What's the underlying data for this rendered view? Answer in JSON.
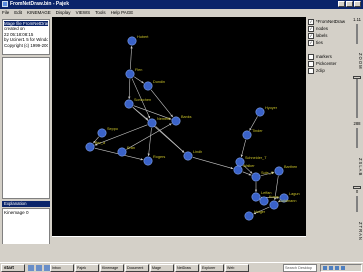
{
  "window": {
    "title": "FromNetDraw.bin - Pajek",
    "menu": [
      "File",
      "Edit",
      "KINEMAGE",
      "Display",
      "VIEWS",
      "Tools",
      "Help PAGE"
    ]
  },
  "info_lines": [
    "Mage file FromNetDraw",
    "created on",
    "22 05:18:08:15",
    "by Uciner1 5 for Windows",
    "Copyright (c) 1999-2005"
  ],
  "explanation_label": "Explanation",
  "kinemage_label": "Kinemage 0",
  "graph": {
    "node_color": "#3a62c8",
    "edge_color": "#c8c8c8",
    "label_color": "#c8c028",
    "nodes": [
      {
        "id": "A",
        "label": "Hubert"
      },
      {
        "id": "B",
        "label": "Flen"
      },
      {
        "id": "C",
        "label": "Dundin"
      },
      {
        "id": "D",
        "label": "Sonnchen"
      },
      {
        "id": "E",
        "label": "Banks"
      },
      {
        "id": "F",
        "label": "Nemeth"
      },
      {
        "id": "G",
        "label": "Seppo"
      },
      {
        "id": "H",
        "label": "Eran"
      },
      {
        "id": "I",
        "label": "Ber_a"
      },
      {
        "id": "J",
        "label": "Rogers"
      },
      {
        "id": "K",
        "label": "Lindh"
      },
      {
        "id": "L",
        "label": "Walker"
      },
      {
        "id": "M",
        "label": "Hyoyer"
      },
      {
        "id": "N",
        "label": "Tinder"
      },
      {
        "id": "O",
        "label": "Schneider_T"
      },
      {
        "id": "P",
        "label": "Sole_G"
      },
      {
        "id": "Q",
        "label": "Leffan"
      },
      {
        "id": "R",
        "label": "Lagun"
      },
      {
        "id": "S",
        "label": "Barthen"
      },
      {
        "id": "T",
        "label": "Goldmann"
      },
      {
        "id": "U",
        "label": "Kraus"
      },
      {
        "id": "V",
        "label": "Holger"
      }
    ],
    "edges": [
      [
        "B",
        "A"
      ],
      [
        "B",
        "C"
      ],
      [
        "B",
        "D"
      ],
      [
        "D",
        "E"
      ],
      [
        "C",
        "E"
      ],
      [
        "D",
        "F"
      ],
      [
        "B",
        "F"
      ],
      [
        "F",
        "I"
      ],
      [
        "G",
        "I"
      ],
      [
        "F",
        "J"
      ],
      [
        "F",
        "K"
      ],
      [
        "D",
        "K"
      ],
      [
        "K",
        "L"
      ],
      [
        "L",
        "O"
      ],
      [
        "L",
        "P"
      ],
      [
        "M",
        "N"
      ],
      [
        "N",
        "O"
      ],
      [
        "O",
        "P"
      ],
      [
        "P",
        "Q"
      ],
      [
        "Q",
        "R"
      ],
      [
        "Q",
        "U"
      ],
      [
        "P",
        "S"
      ],
      [
        "S",
        "T"
      ],
      [
        "T",
        "V"
      ],
      [
        "R",
        "T"
      ],
      [
        "H",
        "E"
      ],
      [
        "I",
        "J"
      ]
    ]
  },
  "options": [
    {
      "label": "*FromNetDraw",
      "checked": true
    },
    {
      "label": "nodes",
      "checked": true
    },
    {
      "label": "labels",
      "checked": true
    },
    {
      "label": "ties",
      "checked": true
    },
    {
      "label": "",
      "checked": false
    },
    {
      "label": "markers",
      "checked": false
    },
    {
      "label": "Pickcenter",
      "checked": false
    },
    {
      "label": "zclip",
      "checked": false
    }
  ],
  "scales": [
    {
      "value": "1.11",
      "label": "ZOOM"
    },
    {
      "value": "288",
      "label": "ZSLAB"
    },
    {
      "value": "0",
      "label": "ZTRAN"
    }
  ],
  "taskbar": {
    "start_label": "start",
    "search_placeholder": "Search Desktop",
    "buttons": [
      "Inbox",
      "Pajek",
      "Kinemage",
      "Document",
      "Mage",
      "NetDraw",
      "Explorer",
      "Web"
    ]
  }
}
